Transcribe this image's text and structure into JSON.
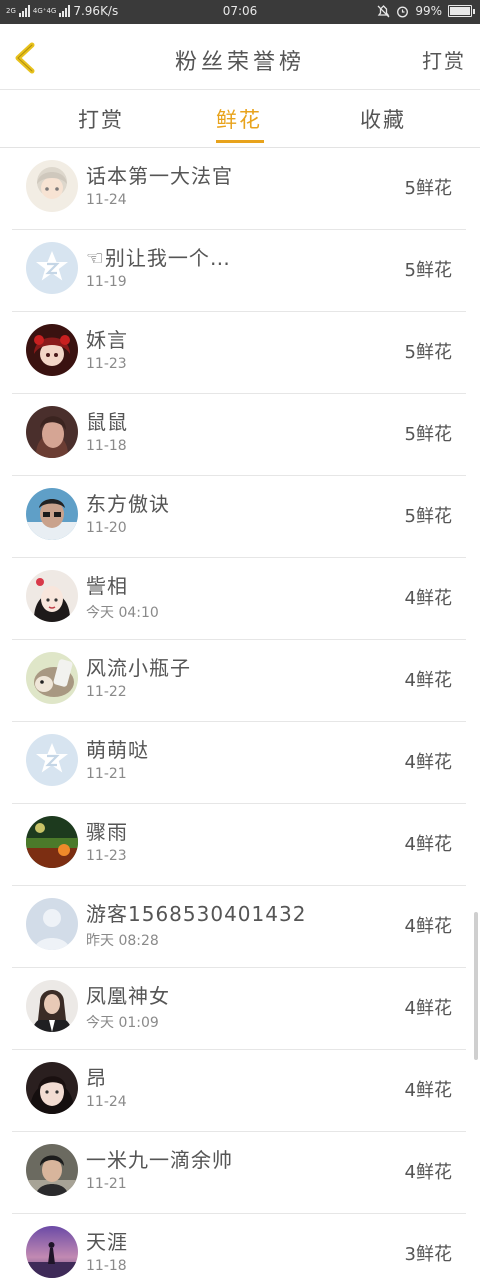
{
  "status_bar": {
    "net_left": "2G",
    "net_mid": "4G⁺4G",
    "speed": "7.96K/s",
    "time": "07:06",
    "battery": "99%",
    "battery_level": 0.99
  },
  "header": {
    "title": "粉丝荣誉榜",
    "action_label": "打赏"
  },
  "tabs": [
    {
      "label": "打赏",
      "active": false
    },
    {
      "label": "鲜花",
      "active": true
    },
    {
      "label": "收藏",
      "active": false
    }
  ],
  "colors": {
    "accent": "#e8a31c",
    "text": "#555555",
    "subtext": "#8a8a8a",
    "divider": "#e6e6e6",
    "status_bar": "#3a3a3a"
  },
  "fans": [
    {
      "name": "话本第一大法官",
      "date": "11-24",
      "count": "5鲜花",
      "avatar": "avatar-anime-girl"
    },
    {
      "name": "☜别让我一个…",
      "date": "11-19",
      "count": "5鲜花",
      "avatar": "avatar-default-z"
    },
    {
      "name": "姀言",
      "date": "11-23",
      "count": "5鲜花",
      "avatar": "avatar-anime-red"
    },
    {
      "name": "鼠鼠",
      "date": "11-18",
      "count": "5鲜花",
      "avatar": "avatar-photo-woman"
    },
    {
      "name": "东方傲诀",
      "date": "11-20",
      "count": "5鲜花",
      "avatar": "avatar-photo-man-glasses"
    },
    {
      "name": "訾相",
      "date": "今天 04:10",
      "count": "4鲜花",
      "avatar": "avatar-anime-bride"
    },
    {
      "name": "风流小瓶子",
      "date": "11-22",
      "count": "4鲜花",
      "avatar": "avatar-hedgehog"
    },
    {
      "name": "萌萌哒",
      "date": "11-21",
      "count": "4鲜花",
      "avatar": "avatar-default-z"
    },
    {
      "name": "骤雨",
      "date": "11-23",
      "count": "4鲜花",
      "avatar": "avatar-photo-field"
    },
    {
      "name": "游客1568530401432",
      "date": "昨天 08:28",
      "count": "4鲜花",
      "avatar": "avatar-default-person"
    },
    {
      "name": "凤凰神女",
      "date": "今天 01:09",
      "count": "4鲜花",
      "avatar": "avatar-photo-girl-suit"
    },
    {
      "name": "昂",
      "date": "11-24",
      "count": "4鲜花",
      "avatar": "avatar-photo-girl-dark"
    },
    {
      "name": "一米九一滴余帅",
      "date": "11-21",
      "count": "4鲜花",
      "avatar": "avatar-photo-boy"
    },
    {
      "name": "天涯",
      "date": "11-18",
      "count": "3鲜花",
      "avatar": "avatar-sunset"
    }
  ]
}
